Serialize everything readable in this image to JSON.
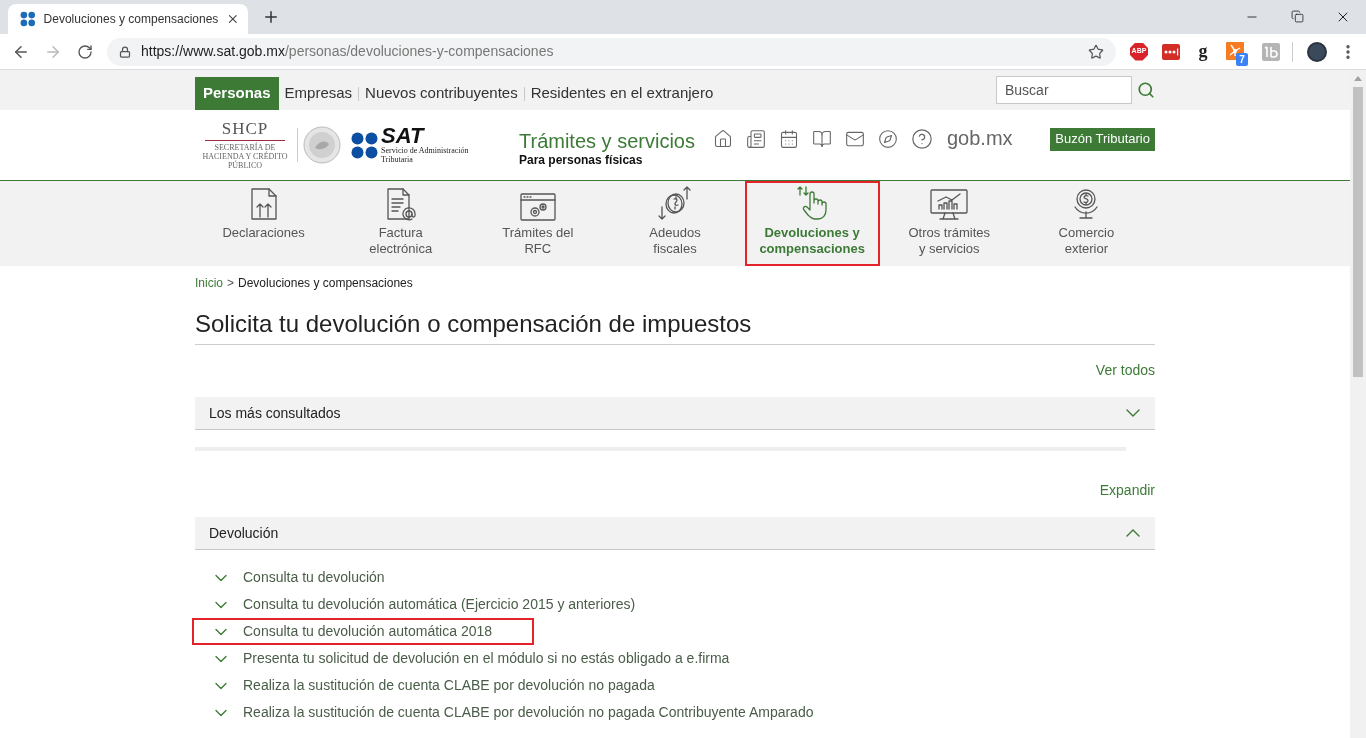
{
  "browser": {
    "tab": {
      "title": "Devoluciones y compensaciones"
    },
    "address": {
      "origin": "https://www.sat.gob.mx",
      "path": "/personas/devoluciones-y-compensaciones"
    },
    "extensions": [
      {
        "kind": "adblock",
        "label": "ABP"
      },
      {
        "kind": "password"
      },
      {
        "kind": "grammar",
        "label": "g"
      },
      {
        "kind": "network",
        "badge": "7"
      },
      {
        "kind": "tile"
      }
    ]
  },
  "top_nav": {
    "items": [
      {
        "label": "Personas",
        "selected": true
      },
      {
        "label": "Empresas",
        "selected": false
      },
      {
        "label": "Nuevos contribuyentes",
        "selected": false
      },
      {
        "label": "Residentes en el extranjero",
        "selected": false
      }
    ],
    "search": {
      "placeholder": "Buscar"
    }
  },
  "header": {
    "shcp_logo": {
      "name": "SHCP",
      "subtitle": "SECRETARÍA DE HACIENDA Y CRÉDITO PÚBLICO"
    },
    "sat_logo": {
      "name": "SAT",
      "subtitle": "Servicio de Administración Tributaria"
    },
    "section_title": "Trámites y servicios",
    "section_subtitle": "Para personas físicas",
    "gob_logo": "gob.mx",
    "mailbox_button": "Buzón Tributario"
  },
  "nav": {
    "items": [
      {
        "label": "Declaraciones",
        "selected": false,
        "highlighted": false
      },
      {
        "label": "Factura\nelectrónica",
        "selected": false,
        "highlighted": false
      },
      {
        "label": "Trámites del\nRFC",
        "selected": false,
        "highlighted": false
      },
      {
        "label": "Adeudos\nfiscales",
        "selected": false,
        "highlighted": false
      },
      {
        "label": "Devoluciones y\ncompensaciones",
        "selected": true,
        "highlighted": true
      },
      {
        "label": "Otros trámites\ny servicios",
        "selected": false,
        "highlighted": false
      },
      {
        "label": "Comercio\nexterior",
        "selected": false,
        "highlighted": false
      }
    ]
  },
  "breadcrumb": {
    "items": [
      {
        "label": "Inicio"
      },
      {
        "label": "Devoluciones y compensaciones"
      }
    ],
    "separator": ">"
  },
  "page_title": "Solicita tu devolución o compensación de impuestos",
  "view_all_link": "Ver todos",
  "featured": {
    "title": "Los más consultados",
    "expanded": false
  },
  "expand_link": "Expandir",
  "section": {
    "title": "Devolución",
    "expanded": true,
    "items": [
      {
        "label": "Consulta tu devolución",
        "highlighted": false
      },
      {
        "label": "Consulta tu devolución automática (Ejercicio 2015 y anteriores)",
        "highlighted": false
      },
      {
        "label": "Consulta tu devolución automática 2018",
        "highlighted": true
      },
      {
        "label": "Presenta tu solicitud de devolución en el módulo si no estás obligado a e.firma",
        "highlighted": false
      },
      {
        "label": "Realiza la sustitución de cuenta CLABE por devolución no pagada",
        "highlighted": false
      },
      {
        "label": "Realiza la sustitución de cuenta CLABE por devolución no pagada Contribuyente Amparado",
        "highlighted": false
      }
    ]
  }
}
